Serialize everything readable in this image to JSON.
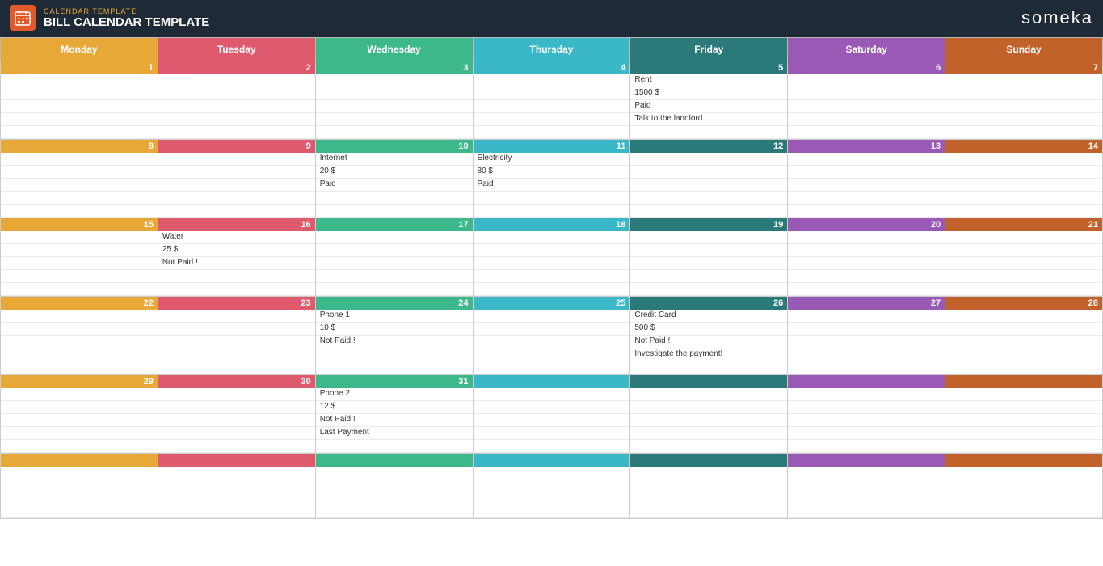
{
  "header": {
    "subtitle": "CALENDAR TEMPLATE",
    "title": "BILL CALENDAR TEMPLATE",
    "brand": "someka"
  },
  "days": [
    "Monday",
    "Tuesday",
    "Wednesday",
    "Thursday",
    "Friday",
    "Saturday",
    "Sunday"
  ],
  "dayClasses": [
    "monday",
    "tuesday",
    "wednesday",
    "thursday",
    "friday",
    "saturday",
    "sunday"
  ],
  "colors": {
    "monday": "#e8a838",
    "tuesday": "#e05a6e",
    "wednesday": "#3db88a",
    "thursday": "#3bb8c8",
    "friday": "#2a7a7a",
    "saturday": "#9b59b6",
    "sunday": "#c0622a"
  },
  "weeks": [
    {
      "days": [
        {
          "num": "1",
          "day": "monday",
          "lines": [
            "",
            "",
            "",
            "",
            ""
          ]
        },
        {
          "num": "2",
          "day": "tuesday",
          "lines": [
            "",
            "",
            "",
            "",
            ""
          ]
        },
        {
          "num": "3",
          "day": "wednesday",
          "lines": [
            "",
            "",
            "",
            "",
            ""
          ]
        },
        {
          "num": "4",
          "day": "thursday",
          "lines": [
            "",
            "",
            "",
            "",
            ""
          ]
        },
        {
          "num": "5",
          "day": "friday",
          "lines": [
            "Rent",
            "1500 $",
            "Paid",
            "Talk to the landlord",
            ""
          ]
        },
        {
          "num": "6",
          "day": "saturday",
          "lines": [
            "",
            "",
            "",
            "",
            ""
          ]
        },
        {
          "num": "7",
          "day": "sunday",
          "lines": [
            "",
            "",
            "",
            "",
            ""
          ]
        }
      ]
    },
    {
      "days": [
        {
          "num": "8",
          "day": "monday",
          "lines": [
            "",
            "",
            "",
            "",
            ""
          ]
        },
        {
          "num": "9",
          "day": "tuesday",
          "lines": [
            "",
            "",
            "",
            "",
            ""
          ]
        },
        {
          "num": "10",
          "day": "wednesday",
          "lines": [
            "Internet",
            "20 $",
            "Paid",
            "",
            ""
          ]
        },
        {
          "num": "11",
          "day": "thursday",
          "lines": [
            "Electricity",
            "80 $",
            "Paid",
            "",
            ""
          ]
        },
        {
          "num": "12",
          "day": "friday",
          "lines": [
            "",
            "",
            "",
            "",
            ""
          ]
        },
        {
          "num": "13",
          "day": "saturday",
          "lines": [
            "",
            "",
            "",
            "",
            ""
          ]
        },
        {
          "num": "14",
          "day": "sunday",
          "lines": [
            "",
            "",
            "",
            "",
            ""
          ]
        }
      ]
    },
    {
      "days": [
        {
          "num": "15",
          "day": "monday",
          "lines": [
            "",
            "",
            "",
            "",
            ""
          ]
        },
        {
          "num": "16",
          "day": "tuesday",
          "lines": [
            "Water",
            "25 $",
            "Not Paid !",
            "",
            ""
          ]
        },
        {
          "num": "17",
          "day": "wednesday",
          "lines": [
            "",
            "",
            "",
            "",
            ""
          ]
        },
        {
          "num": "18",
          "day": "thursday",
          "lines": [
            "",
            "",
            "",
            "",
            ""
          ]
        },
        {
          "num": "19",
          "day": "friday",
          "lines": [
            "",
            "",
            "",
            "",
            ""
          ]
        },
        {
          "num": "20",
          "day": "saturday",
          "lines": [
            "",
            "",
            "",
            "",
            ""
          ]
        },
        {
          "num": "21",
          "day": "sunday",
          "lines": [
            "",
            "",
            "",
            "",
            ""
          ]
        }
      ]
    },
    {
      "days": [
        {
          "num": "22",
          "day": "monday",
          "lines": [
            "",
            "",
            "",
            "",
            ""
          ]
        },
        {
          "num": "23",
          "day": "tuesday",
          "lines": [
            "",
            "",
            "",
            "",
            ""
          ]
        },
        {
          "num": "24",
          "day": "wednesday",
          "lines": [
            "Phone 1",
            "10 $",
            "Not Paid !",
            "",
            ""
          ]
        },
        {
          "num": "25",
          "day": "thursday",
          "lines": [
            "",
            "",
            "",
            "",
            ""
          ]
        },
        {
          "num": "26",
          "day": "friday",
          "lines": [
            "Credit Card",
            "500 $",
            "Not Paid !",
            "Investigate the payment!",
            ""
          ]
        },
        {
          "num": "27",
          "day": "saturday",
          "lines": [
            "",
            "",
            "",
            "",
            ""
          ]
        },
        {
          "num": "28",
          "day": "sunday",
          "lines": [
            "",
            "",
            "",
            "",
            ""
          ]
        }
      ]
    },
    {
      "days": [
        {
          "num": "29",
          "day": "monday",
          "lines": [
            "",
            "",
            "",
            "",
            ""
          ]
        },
        {
          "num": "30",
          "day": "tuesday",
          "lines": [
            "",
            "",
            "",
            "",
            ""
          ]
        },
        {
          "num": "31",
          "day": "wednesday",
          "lines": [
            "Phone 2",
            "12 $",
            "Not Paid !",
            "Last Payment",
            ""
          ]
        },
        {
          "num": "",
          "day": "thursday",
          "lines": [
            "",
            "",
            "",
            "",
            ""
          ]
        },
        {
          "num": "",
          "day": "friday",
          "lines": [
            "",
            "",
            "",
            "",
            ""
          ]
        },
        {
          "num": "",
          "day": "saturday",
          "lines": [
            "",
            "",
            "",
            "",
            ""
          ]
        },
        {
          "num": "",
          "day": "sunday",
          "lines": [
            "",
            "",
            "",
            "",
            ""
          ]
        }
      ]
    },
    {
      "days": [
        {
          "num": "",
          "day": "monday",
          "lines": [
            "",
            "",
            "",
            ""
          ]
        },
        {
          "num": "",
          "day": "tuesday",
          "lines": [
            "",
            "",
            "",
            ""
          ]
        },
        {
          "num": "",
          "day": "wednesday",
          "lines": [
            "",
            "",
            "",
            ""
          ]
        },
        {
          "num": "",
          "day": "thursday",
          "lines": [
            "",
            "",
            "",
            ""
          ]
        },
        {
          "num": "",
          "day": "friday",
          "lines": [
            "",
            "",
            "",
            ""
          ]
        },
        {
          "num": "",
          "day": "saturday",
          "lines": [
            "",
            "",
            "",
            ""
          ]
        },
        {
          "num": "",
          "day": "sunday",
          "lines": [
            "",
            "",
            "",
            ""
          ]
        }
      ]
    }
  ]
}
